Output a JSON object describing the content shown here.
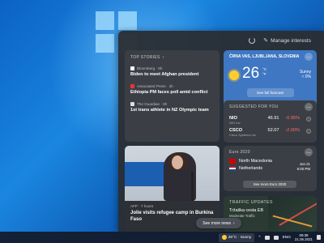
{
  "panel": {
    "manage_label": "Manage interests"
  },
  "top_stories": {
    "header": "TOP STORIES",
    "stories": [
      {
        "source": "Bloomberg · 8h",
        "title": "Biden to meet Afghan president"
      },
      {
        "source": "Associated Press · 4h",
        "title": "Ethiopia PM faces poll amid conflict"
      },
      {
        "source": "The Guardian · 8h",
        "title": "1st trans athlete in NZ Olympic team"
      }
    ]
  },
  "weather": {
    "location": "ČRNA VAS, LJUBLJANA, SLOVENIA",
    "temp": "26",
    "unit_c": "°C",
    "unit_f": "°F",
    "condition": "Sunny",
    "details": "≈ 0%",
    "forecast_button": "See full forecast"
  },
  "finance": {
    "header": "SUGGESTED FOR YOU",
    "rows": [
      {
        "symbol": "NIO",
        "name": "NIO Inc",
        "price": "46.91",
        "change": "-0.95%"
      },
      {
        "symbol": "CSCO",
        "name": "Cisco Systems Inc",
        "price": "52.07",
        "change": "-2.00%"
      }
    ]
  },
  "image_story": {
    "source": "AFP · 7 hours",
    "title": "Jolie visits refugee camp in Burkina Faso"
  },
  "euro": {
    "header": "Euro 2020",
    "team1": "North Macedonia",
    "team2": "Netherlands",
    "date": "Jun 21",
    "time": "6:00 PM",
    "button": "See more Euro 2020"
  },
  "traffic": {
    "header": "TRAFFIC UPDATES",
    "title": "Tržaška cesta EB",
    "subtitle": "Moderate Traffic"
  },
  "see_more": "See more news",
  "taskbar": {
    "weather": "26°C · Sunny",
    "lang": "ENG",
    "time": "09:39",
    "date": "21.06.2021"
  },
  "colors": {
    "panel_bg": "#2a2e34",
    "weather_card": "#3f77c2",
    "negative": "#ff6b6b"
  }
}
